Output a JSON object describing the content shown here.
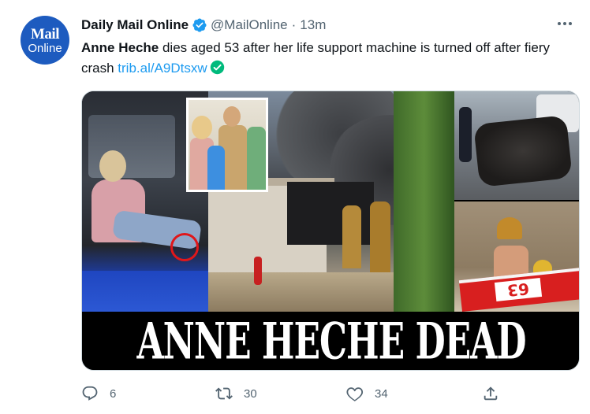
{
  "author": {
    "avatar_line1": "Mail",
    "avatar_line2": "Online",
    "display_name": "Daily Mail Online",
    "handle": "@MailOnline",
    "separator": "·",
    "timestamp": "13m"
  },
  "tweet": {
    "bold_name": "Anne Heche",
    "body": " dies aged 53 after her life support machine is turned off after fiery crash ",
    "link": "trib.al/A9Dtsxw"
  },
  "media": {
    "banner_text": "ANNE HECHE DEAD",
    "plate_number": "63"
  },
  "actions": {
    "reply_count": "6",
    "retweet_count": "30",
    "like_count": "34"
  },
  "icons": {
    "verified": "verified-badge-icon",
    "more": "more-options-icon",
    "reply": "reply-icon",
    "retweet": "retweet-icon",
    "like": "heart-icon",
    "share": "share-icon",
    "link_check": "check-circle-icon"
  },
  "colors": {
    "brand_blue": "#1d9bf0",
    "link_check_green": "#00ba7c",
    "avatar_bg": "#1d5bbf",
    "muted_text": "#536471"
  }
}
